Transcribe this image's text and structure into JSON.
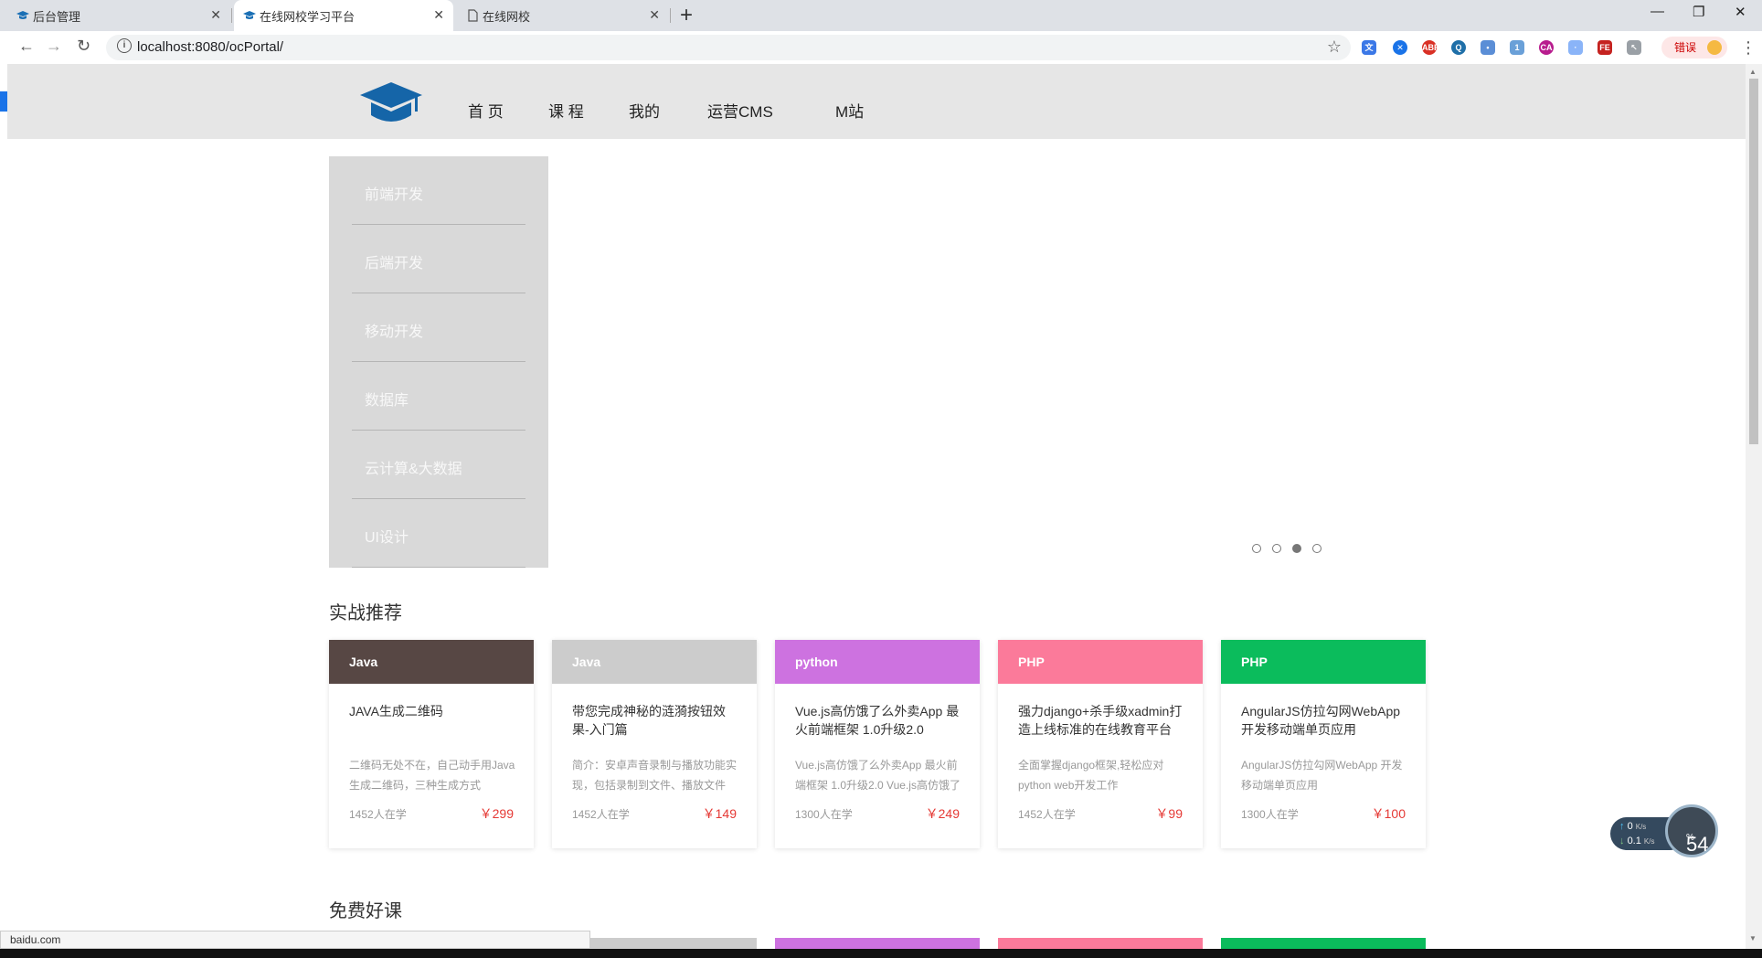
{
  "browser": {
    "tabs": [
      {
        "title": "后台管理",
        "active": false
      },
      {
        "title": "在线网校学习平台",
        "active": true
      },
      {
        "title": "在线网校",
        "active": false
      }
    ],
    "url": "localhost:8080/ocPortal/",
    "error_label": "错误",
    "status_url": "baidu.com"
  },
  "header": {
    "nav": [
      "首 页",
      "课 程",
      "我的",
      "运营CMS",
      "M站"
    ]
  },
  "sidebar": {
    "items": [
      "前端开发",
      "后端开发",
      "移动开发",
      "数据库",
      "云计算&大数据",
      "UI设计"
    ]
  },
  "carousel": {
    "dot_count": 4,
    "active_index": 2
  },
  "sections": {
    "recommend": "实战推荐",
    "free": "免费好课"
  },
  "cards": [
    {
      "category": "Java",
      "color": "#574744",
      "title": "JAVA生成二维码",
      "desc": "二维码无处不在，自己动手用Java生成二维码，三种生成方式",
      "students": "1452人在学",
      "price": "￥299"
    },
    {
      "category": "Java",
      "color": "#cccccc",
      "title": "带您完成神秘的涟漪按钮效果-入门篇",
      "desc": "简介：安卓声音录制与播放功能实现，包括录制到文件、播放文件",
      "students": "1452人在学",
      "price": "￥149"
    },
    {
      "category": "python",
      "color": "#cd72e0",
      "title": "Vue.js高仿饿了么外卖App 最火前端框架 1.0升级2.0",
      "desc": "Vue.js高仿饿了么外卖App 最火前端框架 1.0升级2.0 Vue.js高仿饿了么",
      "students": "1300人在学",
      "price": "￥249"
    },
    {
      "category": "PHP",
      "color": "#fb7a9a",
      "title": "强力django+杀手级xadmin打造上线标准的在线教育平台",
      "desc": "全面掌握django框架,轻松应对python web开发工作",
      "students": "1452人在学",
      "price": "￥99"
    },
    {
      "category": "PHP",
      "color": "#0bbc5c",
      "title": "AngularJS仿拉勾网WebApp开发移动端单页应用",
      "desc": "AngularJS仿拉勾网WebApp 开发移动端单页应用",
      "students": "1300人在学",
      "price": "￥100"
    }
  ],
  "speed_widget": {
    "up": "0",
    "down": "0.1",
    "unit": "K/s",
    "percent": "54",
    "percent_unit": "%"
  }
}
